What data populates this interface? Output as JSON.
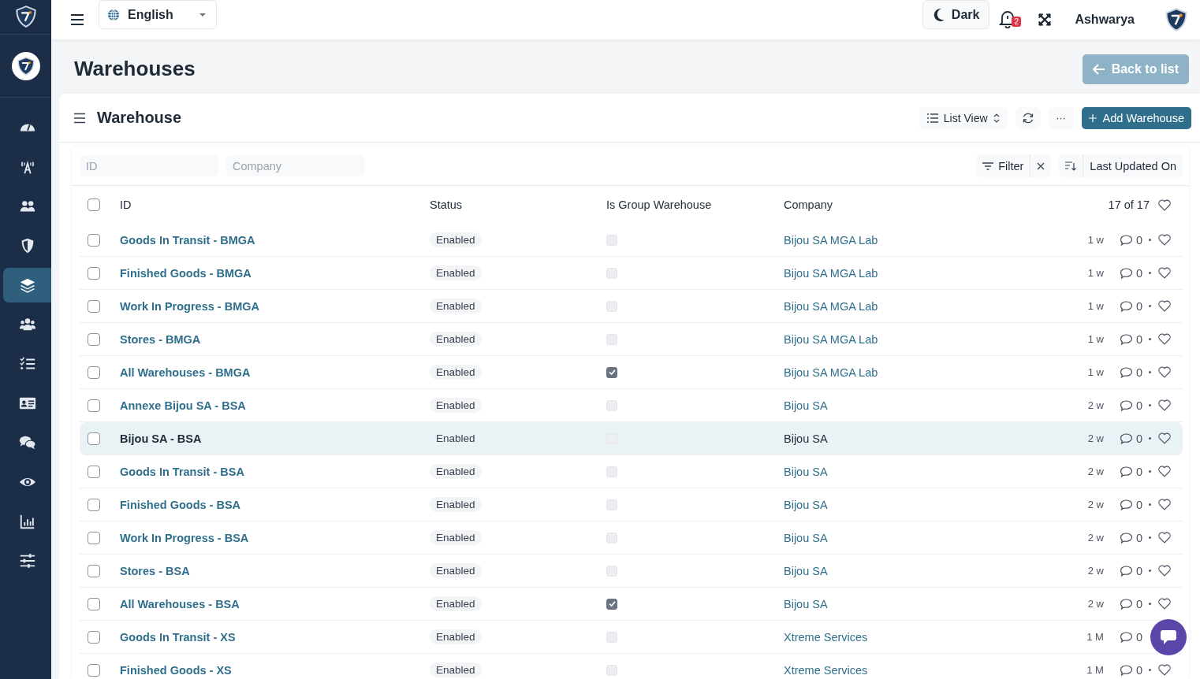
{
  "topbar": {
    "language": "English",
    "theme_button": "Dark",
    "notification_count": "2",
    "user": "Ashwarya"
  },
  "sidebar": {
    "items": [
      {
        "kind": "dashboard",
        "selected": false
      },
      {
        "kind": "antenna",
        "selected": false
      },
      {
        "kind": "users",
        "selected": false
      },
      {
        "kind": "shield",
        "selected": false
      },
      {
        "kind": "layers",
        "selected": true
      },
      {
        "kind": "group",
        "selected": false
      },
      {
        "kind": "checklist",
        "selected": false
      },
      {
        "kind": "idcard",
        "selected": false
      },
      {
        "kind": "chat",
        "selected": false
      },
      {
        "kind": "eye",
        "selected": false
      },
      {
        "kind": "chart",
        "selected": false
      },
      {
        "kind": "sliders",
        "selected": false
      }
    ]
  },
  "page": {
    "title": "Warehouses",
    "back_button": "Back to list"
  },
  "list": {
    "title": "Warehouse",
    "view_button": "List View",
    "more_button": "···",
    "add_button": "Add Warehouse",
    "filters": [
      {
        "placeholder": "ID"
      },
      {
        "placeholder": "Company"
      }
    ],
    "filter_button": "Filter",
    "sort_button": "Last Updated On",
    "columns": [
      "ID",
      "Status",
      "Is Group Warehouse",
      "Company"
    ],
    "count": "17 of 17",
    "select_all_checked": false,
    "rows": [
      {
        "id": "Goods In Transit - BMGA",
        "status": "Enabled",
        "is_group": false,
        "company": "Bijou SA MGA Lab",
        "age": "1 w",
        "comments": "0",
        "highlighted": false,
        "meta_covered": false,
        "checked": false
      },
      {
        "id": "Finished Goods - BMGA",
        "status": "Enabled",
        "is_group": false,
        "company": "Bijou SA MGA Lab",
        "age": "1 w",
        "comments": "0",
        "highlighted": false,
        "meta_covered": false,
        "checked": false
      },
      {
        "id": "Work In Progress - BMGA",
        "status": "Enabled",
        "is_group": false,
        "company": "Bijou SA MGA Lab",
        "age": "1 w",
        "comments": "0",
        "highlighted": false,
        "meta_covered": false,
        "checked": false
      },
      {
        "id": "Stores - BMGA",
        "status": "Enabled",
        "is_group": false,
        "company": "Bijou SA MGA Lab",
        "age": "1 w",
        "comments": "0",
        "highlighted": false,
        "meta_covered": false,
        "checked": false
      },
      {
        "id": "All Warehouses - BMGA",
        "status": "Enabled",
        "is_group": true,
        "company": "Bijou SA MGA Lab",
        "age": "1 w",
        "comments": "0",
        "highlighted": false,
        "meta_covered": false,
        "checked": false
      },
      {
        "id": "Annexe Bijou SA - BSA",
        "status": "Enabled",
        "is_group": false,
        "company": "Bijou SA",
        "age": "2 w",
        "comments": "0",
        "highlighted": false,
        "meta_covered": false,
        "checked": false
      },
      {
        "id": "Bijou SA - BSA",
        "status": "Enabled",
        "is_group": false,
        "company": "Bijou SA",
        "age": "2 w",
        "comments": "0",
        "highlighted": true,
        "meta_covered": false,
        "checked": false
      },
      {
        "id": "Goods In Transit - BSA",
        "status": "Enabled",
        "is_group": false,
        "company": "Bijou SA",
        "age": "2 w",
        "comments": "0",
        "highlighted": false,
        "meta_covered": false,
        "checked": false
      },
      {
        "id": "Finished Goods - BSA",
        "status": "Enabled",
        "is_group": false,
        "company": "Bijou SA",
        "age": "2 w",
        "comments": "0",
        "highlighted": false,
        "meta_covered": false,
        "checked": false
      },
      {
        "id": "Work In Progress - BSA",
        "status": "Enabled",
        "is_group": false,
        "company": "Bijou SA",
        "age": "2 w",
        "comments": "0",
        "highlighted": false,
        "meta_covered": false,
        "checked": false
      },
      {
        "id": "Stores - BSA",
        "status": "Enabled",
        "is_group": false,
        "company": "Bijou SA",
        "age": "2 w",
        "comments": "0",
        "highlighted": false,
        "meta_covered": false,
        "checked": false
      },
      {
        "id": "All Warehouses - BSA",
        "status": "Enabled",
        "is_group": true,
        "company": "Bijou SA",
        "age": "2 w",
        "comments": "0",
        "highlighted": false,
        "meta_covered": false,
        "checked": false
      },
      {
        "id": "Goods In Transit - XS",
        "status": "Enabled",
        "is_group": false,
        "company": "Xtreme Services",
        "age": "1 M",
        "comments": "0",
        "highlighted": false,
        "meta_covered": true,
        "checked": false
      },
      {
        "id": "Finished Goods - XS",
        "status": "Enabled",
        "is_group": false,
        "company": "Xtreme Services",
        "age": "1 M",
        "comments": "0",
        "highlighted": false,
        "meta_covered": false,
        "checked": false
      }
    ]
  }
}
